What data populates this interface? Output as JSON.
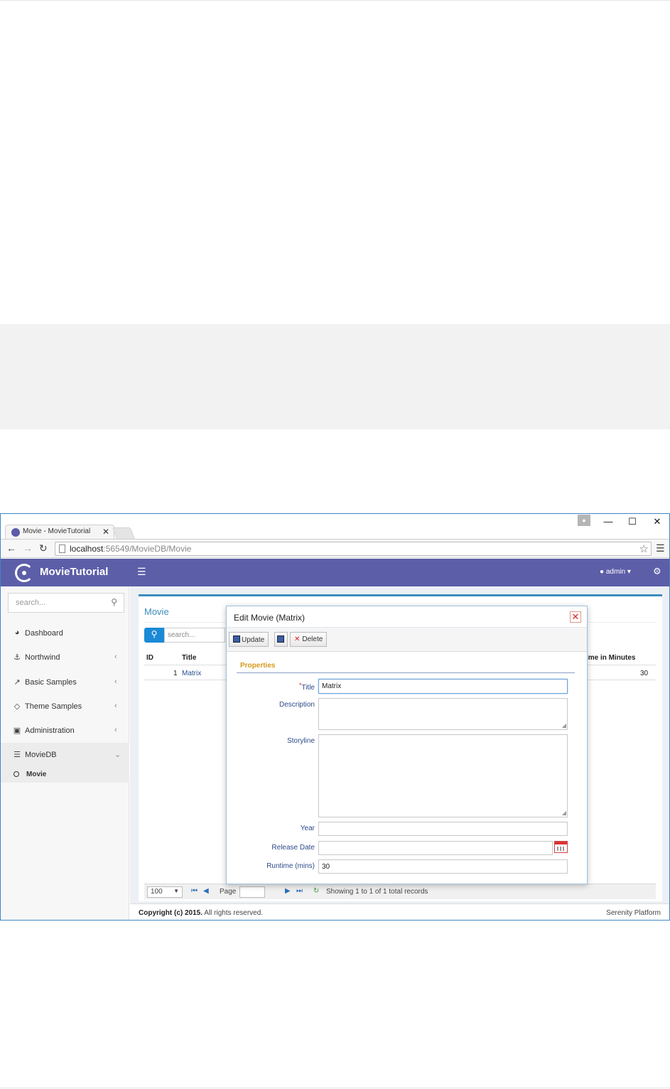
{
  "browser": {
    "tab_title": "Movie - MovieTutorial",
    "tab_close": "✕",
    "url_host": "localhost",
    "url_rest": ":56549/MovieDB/Movie",
    "window_controls": {
      "minimize": "—",
      "maximize": "☐",
      "close": "✕"
    }
  },
  "app": {
    "brand": "MovieTutorial",
    "user": "admin",
    "search_placeholder": "search...",
    "menu": [
      {
        "label": "Dashboard",
        "icon": "dashboard-icon"
      },
      {
        "label": "Northwind",
        "icon": "anchor-icon"
      },
      {
        "label": "Basic Samples",
        "icon": "magic-wand-icon"
      },
      {
        "label": "Theme Samples",
        "icon": "diamond-icon"
      },
      {
        "label": "Administration",
        "icon": "monitor-icon"
      },
      {
        "label": "MovieDB",
        "icon": "layers-icon"
      }
    ],
    "submenu": {
      "label": "Movie"
    }
  },
  "grid": {
    "title": "Movie",
    "search_placeholder": "search...",
    "columns": {
      "id": "ID",
      "title": "Title",
      "runtime": "ime in Minutes"
    },
    "rows": [
      {
        "id": "1",
        "title": "Matrix",
        "runtime": "30"
      }
    ],
    "pager": {
      "page_size": "100",
      "page_label": "Page",
      "status": "Showing 1 to 1 of 1 total records"
    }
  },
  "dialog": {
    "title": "Edit Movie (Matrix)",
    "update_label": "Update",
    "delete_label": "Delete",
    "category": "Properties",
    "fields": {
      "title": {
        "label": "Title",
        "value": "Matrix"
      },
      "description": {
        "label": "Description",
        "value": ""
      },
      "storyline": {
        "label": "Storyline",
        "value": ""
      },
      "year": {
        "label": "Year",
        "value": ""
      },
      "release_date": {
        "label": "Release Date",
        "value": ""
      },
      "runtime": {
        "label": "Runtime (mins)",
        "value": "30"
      }
    }
  },
  "footer": {
    "copyright_bold": "Copyright (c) 2015.",
    "copyright_rest": " All rights reserved.",
    "platform": "Serenity Platform"
  },
  "colors": {
    "appbar": "#5c5ea8",
    "accent": "#3c8dbc",
    "category": "#d49a1a",
    "window_border": "#3f87c4"
  }
}
